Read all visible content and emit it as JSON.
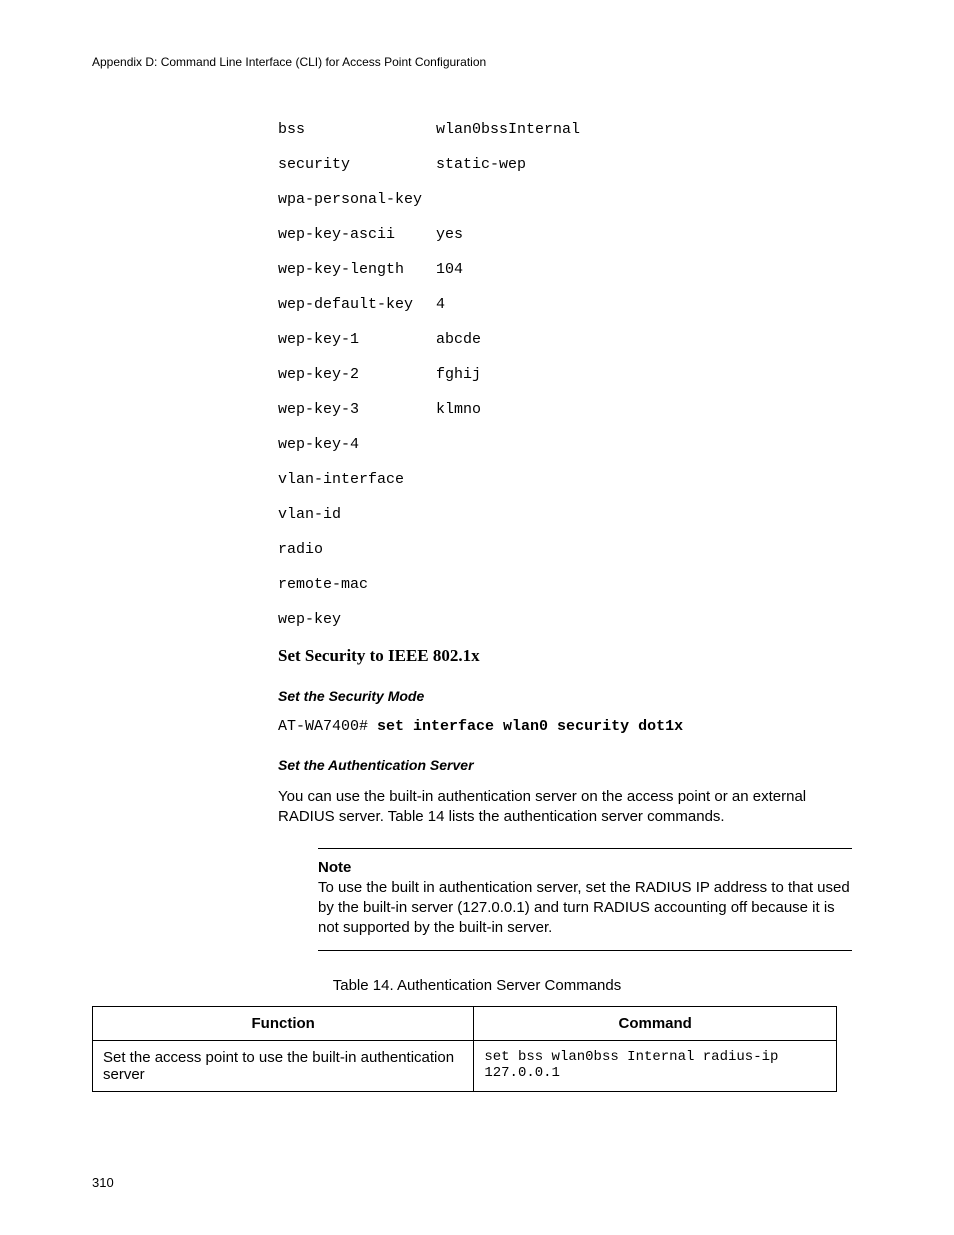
{
  "header": "Appendix D: Command Line Interface (CLI) for Access Point Configuration",
  "config": [
    {
      "key": "bss",
      "val": "wlan0bssInternal"
    },
    {
      "key": "security",
      "val": "static-wep"
    },
    {
      "key": "wpa-personal-key",
      "val": ""
    },
    {
      "key": "wep-key-ascii",
      "val": "yes"
    },
    {
      "key": "wep-key-length",
      "val": "104"
    },
    {
      "key": "wep-default-key",
      "val": "4"
    },
    {
      "key": "wep-key-1",
      "val": "abcde"
    },
    {
      "key": "wep-key-2",
      "val": "fghij"
    },
    {
      "key": "wep-key-3",
      "val": "klmno"
    },
    {
      "key": "wep-key-4",
      "val": ""
    },
    {
      "key": "vlan-interface",
      "val": ""
    },
    {
      "key": "vlan-id",
      "val": ""
    },
    {
      "key": "radio",
      "val": ""
    },
    {
      "key": "remote-mac",
      "val": ""
    },
    {
      "key": "wep-key",
      "val": ""
    }
  ],
  "section_title": "Set Security to IEEE 802.1x",
  "sub1": "Set the Security Mode",
  "cli": {
    "prompt": "AT-WA7400# ",
    "cmd": "set interface wlan0 security dot1x"
  },
  "sub2": "Set the Authentication Server",
  "body": "You can use the built-in authentication server on the access point or an external RADIUS server. Table 14 lists the authentication server commands.",
  "note_label": "Note",
  "note_text": "To use the built in authentication server, set the RADIUS IP address to that used by the built-in server (127.0.0.1) and turn RADIUS accounting off because it is not supported by the built-in server.",
  "table_caption": "Table 14. Authentication Server Commands",
  "table": {
    "headers": [
      "Function",
      "Command"
    ],
    "rows": [
      {
        "function": "Set the access point to use the built-in authentication server",
        "command": "set bss wlan0bss Internal radius-ip 127.0.0.1"
      }
    ]
  },
  "page_number": "310"
}
